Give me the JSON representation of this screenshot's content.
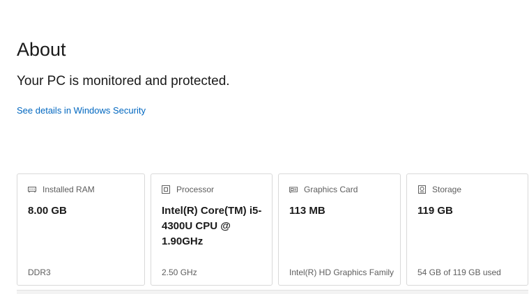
{
  "header": {
    "title": "About",
    "status": "Your PC is monitored and protected.",
    "link": "See details in Windows Security"
  },
  "cards": [
    {
      "icon": "ram-icon",
      "label": "Installed RAM",
      "value": "8.00 GB",
      "detail": "DDR3"
    },
    {
      "icon": "processor-icon",
      "label": "Processor",
      "value": "Intel(R) Core(TM) i5-4300U CPU @ 1.90GHz",
      "detail": "2.50 GHz"
    },
    {
      "icon": "graphics-card-icon",
      "label": "Graphics Card",
      "value": "113 MB",
      "detail": "Intel(R) HD Graphics Family"
    },
    {
      "icon": "storage-icon",
      "label": "Storage",
      "value": "119 GB",
      "detail": "54 GB of 119 GB used"
    }
  ],
  "colors": {
    "accent": "#0067c0",
    "border": "#d9d9d9",
    "secondary_text": "#5d5d5d"
  }
}
